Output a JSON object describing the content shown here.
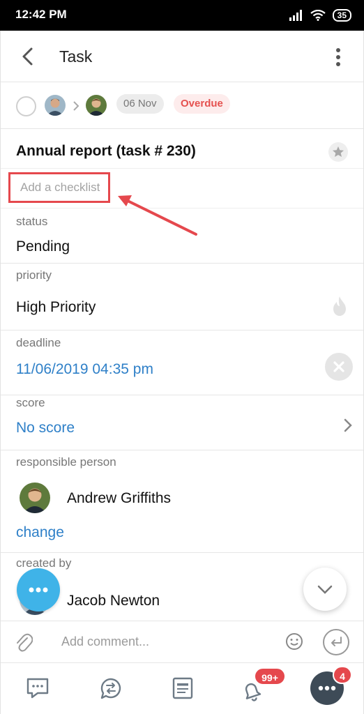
{
  "status_bar": {
    "time": "12:42 PM",
    "battery": "35"
  },
  "header": {
    "title": "Task",
    "back_icon": "chevron-left-icon",
    "menu_icon": "more-vertical-icon"
  },
  "meta": {
    "date_chip": "06 Nov",
    "overdue_chip": "Overdue"
  },
  "task": {
    "title": "Annual report (task # 230)",
    "checklist_placeholder": "Add a checklist"
  },
  "fields": {
    "status": {
      "label": "status",
      "value": "Pending"
    },
    "priority": {
      "label": "priority",
      "value": "High Priority"
    },
    "deadline": {
      "label": "deadline",
      "value": "11/06/2019 04:35 pm"
    },
    "score": {
      "label": "score",
      "value": "No score"
    },
    "responsible": {
      "label": "responsible person",
      "name": "Andrew Griffiths",
      "change": "change"
    },
    "created_by": {
      "label": "created by",
      "name": "Jacob Newton"
    }
  },
  "comment": {
    "placeholder": "Add comment..."
  },
  "nav": {
    "notifications_badge": "99+",
    "more_badge": "4"
  },
  "colors": {
    "accent_link": "#2f80c8",
    "overdue": "#e5514f",
    "highlight_box": "#e5484d",
    "fab": "#3fb3e8"
  }
}
